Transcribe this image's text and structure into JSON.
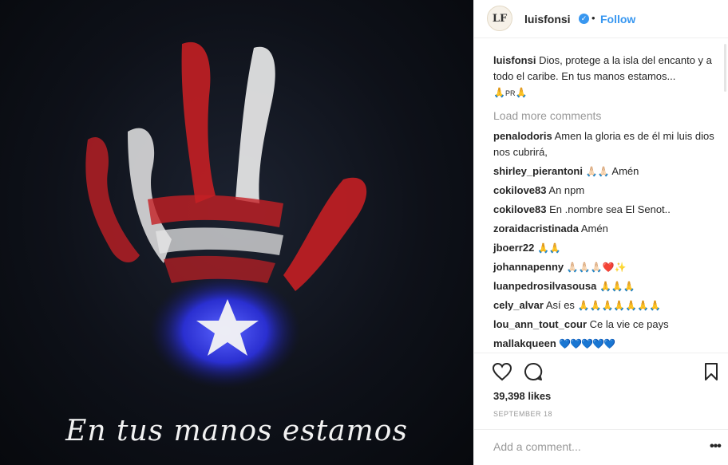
{
  "photo": {
    "overlay_text": "En tus manos estamos"
  },
  "header": {
    "avatar_text": "LF",
    "username": "luisfonsi",
    "dot": "•",
    "follow_label": "Follow"
  },
  "caption": {
    "username": "luisfonsi",
    "text": "Dios, protege a la isla del encanto y a todo el caribe. En tus manos estamos...",
    "tail": "PR"
  },
  "load_more": "Load more comments",
  "comments": [
    {
      "user": "penalodoris",
      "text": "Amen la gloria es de él mi luis dios nos cubrirá,"
    },
    {
      "user": "shirley_pierantoni",
      "text": "Amén",
      "emoji": "🙏🏻🙏🏻"
    },
    {
      "user": "cokilove83",
      "text": "An npm"
    },
    {
      "user": "cokilove83",
      "text": "En .nombre sea El Senot.."
    },
    {
      "user": "zoraidacristinada",
      "text": "Amén"
    },
    {
      "user": "jboerr22",
      "text": "",
      "emoji": "🙏🙏"
    },
    {
      "user": "johannapenny",
      "text": "",
      "emoji": "🙏🏻🙏🏻🙏🏻❤️✨"
    },
    {
      "user": "luanpedrosilvasousa",
      "text": "",
      "emoji": "🙏🙏🙏"
    },
    {
      "user": "cely_alvar",
      "text": "Así es",
      "emoji": "🙏🙏🙏🙏🙏🙏🙏"
    },
    {
      "user": "lou_ann_tout_cour",
      "text": "Ce la vie ce pays"
    },
    {
      "user": "mallakqueen",
      "text": "",
      "emoji": "💙💙💙💙💙"
    }
  ],
  "likes": "39,398 likes",
  "date": "SEPTEMBER 18",
  "add_comment_placeholder": "Add a comment...",
  "more_label": "•••",
  "icons": [
    "heart-icon",
    "comment-icon",
    "bookmark-icon"
  ],
  "colors": {
    "accent": "#3897f0",
    "text": "#262626",
    "muted": "#999999"
  }
}
